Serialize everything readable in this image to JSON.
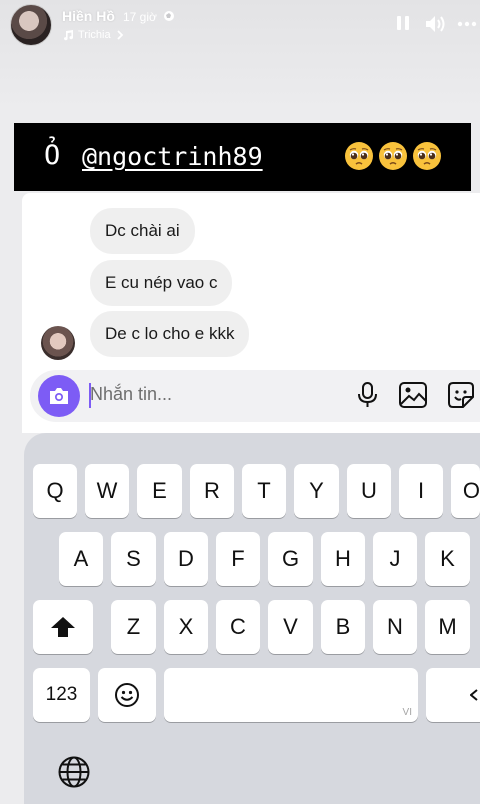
{
  "story": {
    "user_name": "Hiền Hồ",
    "time_ago": "17 giờ",
    "music_title": "Trichia"
  },
  "banner": {
    "prefix": "Ỏ",
    "mention": "@ngoctrinh89",
    "emoji": "pleading-face-icon x3"
  },
  "chat": {
    "messages": [
      "Dc chài ai",
      "E cu nép vao c",
      "De c lo cho e kkk"
    ]
  },
  "composer": {
    "placeholder": "Nhắn tin..."
  },
  "keyboard": {
    "row1": [
      "Q",
      "W",
      "E",
      "R",
      "T",
      "Y",
      "U",
      "I",
      "O"
    ],
    "row2": [
      "A",
      "S",
      "D",
      "F",
      "G",
      "H",
      "J",
      "K"
    ],
    "row3": [
      "Z",
      "X",
      "C",
      "V",
      "B",
      "N",
      "M"
    ],
    "numbers_key": "123",
    "space_hint": "VI"
  },
  "colors": {
    "accent": "#7d5cf5",
    "banner_bg": "#000000",
    "bubble_bg": "#efefef",
    "keyboard_bg": "#d6d8de"
  }
}
